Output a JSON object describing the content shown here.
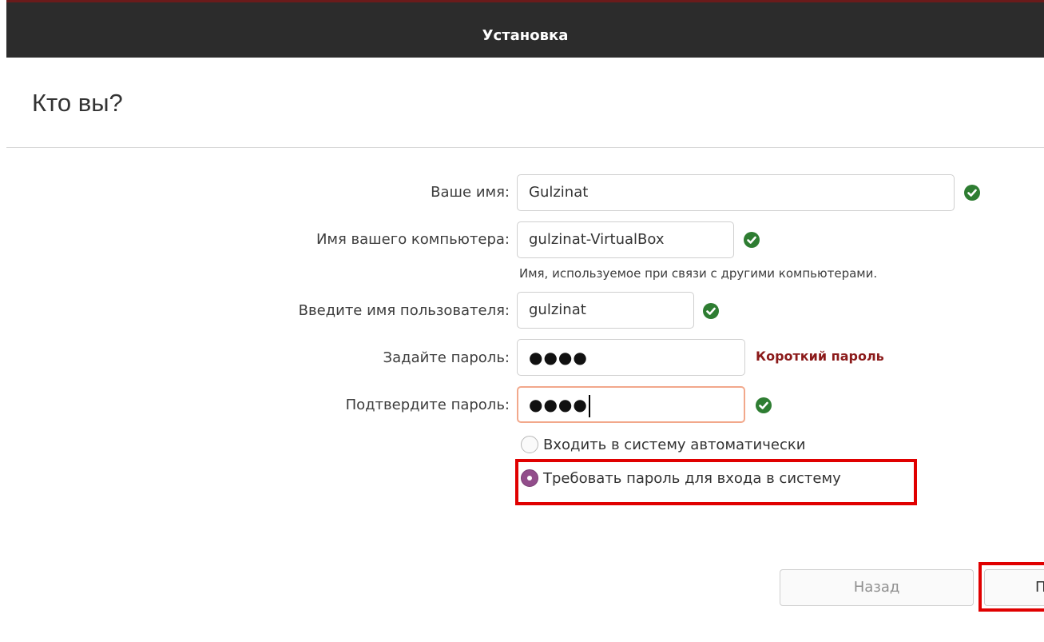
{
  "window": {
    "title": "Установка"
  },
  "page": {
    "heading": "Кто вы?"
  },
  "form": {
    "name": {
      "label": "Ваше имя:",
      "value": "Gulzinat"
    },
    "computer": {
      "label": "Имя вашего компьютера:",
      "value": "gulzinat-VirtualBox",
      "hint": "Имя, используемое при связи с другими компьютерами."
    },
    "username": {
      "label": "Введите имя пользователя:",
      "value": "gulzinat"
    },
    "password": {
      "label": "Задайте пароль:",
      "value": "●●●●",
      "strength": "Короткий пароль"
    },
    "confirm": {
      "label": "Подтвердите пароль:",
      "value": "●●●●"
    },
    "options": [
      {
        "label": "Входить в систему автоматически",
        "selected": false
      },
      {
        "label": "Требовать пароль для входа в систему",
        "selected": true
      }
    ]
  },
  "buttons": {
    "back": "Назад",
    "next": "Пр"
  },
  "colors": {
    "accent": "#924d8b",
    "ok": "#2e7d32",
    "warning": "#8b1a1a",
    "highlight": "#e00000"
  }
}
